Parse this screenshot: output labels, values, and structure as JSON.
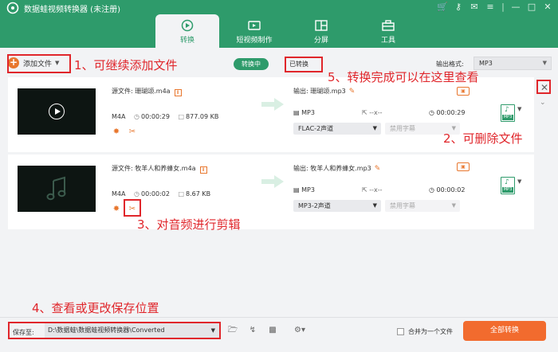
{
  "app": {
    "title": "数据蛙视频转换器 (未注册)",
    "window_icons": [
      "cart-icon",
      "key-icon",
      "feedback-icon",
      "menu-icon",
      "minimize-icon",
      "maximize-icon",
      "close-icon"
    ]
  },
  "tabs": [
    {
      "label": "转换",
      "icon": "convert-icon",
      "active": true
    },
    {
      "label": "短视频制作",
      "icon": "video-maker-icon",
      "active": false
    },
    {
      "label": "分屏",
      "icon": "split-screen-icon",
      "active": false
    },
    {
      "label": "工具",
      "icon": "toolbox-icon",
      "active": false
    }
  ],
  "toolbar": {
    "add_file": "添加文件",
    "converting": "转换中",
    "converted": "已转换",
    "output_format_label": "输出格式:",
    "output_format_value": "MP3"
  },
  "files": [
    {
      "source": "源文件: 珊瑚颂.m4a",
      "format": "M4A",
      "duration": "00:00:29",
      "size": "877.09 KB",
      "output": "输出: 珊瑚颂.mp3",
      "out_format": "MP3",
      "out_resolution": "--x--",
      "out_duration": "00:00:29",
      "audio_track": "FLAC-2声道",
      "subtitle": "禁用字幕",
      "thumb_type": "video"
    },
    {
      "source": "源文件: 牧羊人和养蜂女.m4a",
      "format": "M4A",
      "duration": "00:00:02",
      "size": "8.67 KB",
      "output": "输出: 牧羊人和养蜂女.mp3",
      "out_format": "MP3",
      "out_resolution": "--x--",
      "out_duration": "00:00:02",
      "audio_track": "MP3-2声道",
      "subtitle": "禁用字幕",
      "thumb_type": "audio"
    }
  ],
  "badge": {
    "label": "MP3"
  },
  "bottom": {
    "save_to": "保存至:",
    "save_path": "D:\\数据蛙\\数据蛙视频转换器\\Converted",
    "merge": "合并为一个文件",
    "convert_all": "全部转换"
  },
  "annotations": {
    "a1": "1、可继续添加文件",
    "a2": "2、可删除文件",
    "a3": "3、对音频进行剪辑",
    "a4": "4、查看或更改保存位置",
    "a5": "5、转换完成可以在这里查看"
  },
  "colors": {
    "accent": "#2e9b6b",
    "orange": "#f26b2e",
    "annotation": "#e0262b"
  }
}
